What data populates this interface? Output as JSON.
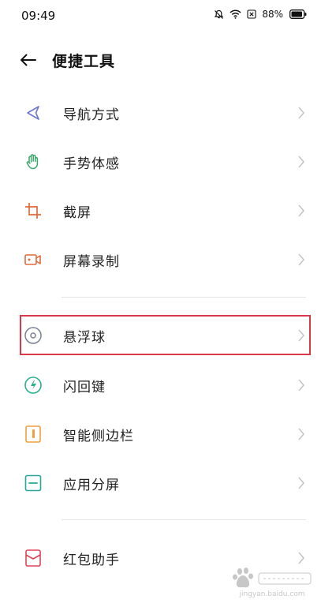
{
  "status_bar": {
    "time": "09:49",
    "battery": "88%"
  },
  "header": {
    "title": "便捷工具"
  },
  "items": [
    {
      "label": "导航方式",
      "icon": "navigation-icon",
      "color": "#6c78c9"
    },
    {
      "label": "手势体感",
      "icon": "hand-gesture-icon",
      "color": "#3aa86a"
    },
    {
      "label": "截屏",
      "icon": "screenshot-crop-icon",
      "color": "#e06a3c"
    },
    {
      "label": "屏幕录制",
      "icon": "screen-record-icon",
      "color": "#e06a3c"
    },
    {
      "label": "悬浮球",
      "icon": "floating-ball-icon",
      "color": "#7b8194"
    },
    {
      "label": "闪回键",
      "icon": "flashback-key-icon",
      "color": "#2bb08d"
    },
    {
      "label": "智能侧边栏",
      "icon": "smart-sidebar-icon",
      "color": "#f0a03a"
    },
    {
      "label": "应用分屏",
      "icon": "split-screen-icon",
      "color": "#27a89b"
    },
    {
      "label": "红包助手",
      "icon": "red-envelope-icon",
      "color": "#e04456"
    }
  ],
  "watermark": {
    "text": "jingyan.baidu.com"
  },
  "colors": {
    "highlight": "#d9374a",
    "chevron": "#c4c4c4",
    "divider": "#e5e5e5"
  }
}
